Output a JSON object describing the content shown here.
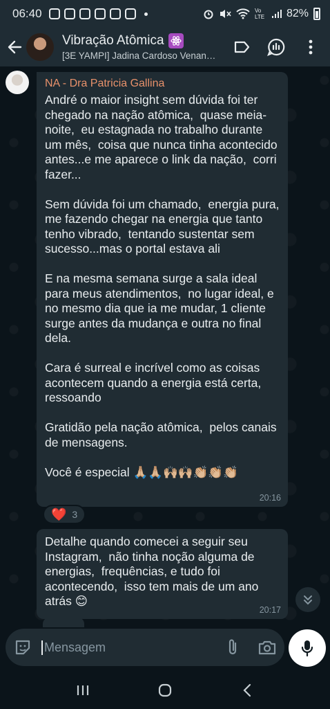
{
  "status_bar": {
    "time": "06:40",
    "battery": "82%",
    "network": "Vo LTE"
  },
  "header": {
    "title": "Vibração Atômica",
    "subtitle": "[3E YAMPI] Jadina Cardoso Venan…",
    "icons": [
      "back-arrow-icon",
      "avatar",
      "atom-badge-icon",
      "label-icon",
      "community-icon",
      "more-vert-icon"
    ]
  },
  "messages": [
    {
      "sender": "NA - Dra Patricia Gallina",
      "text": "André o maior insight sem dúvida foi ter chegado na nação atômica,  quase meia-noite,  eu estagnada no trabalho durante um mês,  coisa que nunca tinha acontecido antes...e me aparece o link da nação,  corri fazer...\n\nSem dúvida foi um chamado,  energia pura, me fazendo chegar na energia que tanto tenho vibrado,  tentando sustentar sem sucesso...mas o portal estava ali\n\nE na mesma semana surge a sala ideal para meus atendimentos,  no lugar ideal, e no mesmo dia que ia me mudar, 1 cliente surge antes da mudança e outra no final dela.\n\nCara é surreal e incrível como as coisas acontecem quando a energia está certa, ressoando\n\nGratidão pela nação atômica,  pelos canais de mensagens.\n\nVocê é especial 🙏🏼🙏🏼🙌🏼🙌🏼👏🏼👏🏼👏🏼",
      "time": "20:16",
      "reaction_emoji": "❤️",
      "reaction_count": "3"
    },
    {
      "text": "Detalhe quando comecei a seguir seu Instagram,  não tinha noção alguma de energias,  frequências, e tudo foi acontecendo,  isso tem mais de um ano atrás 😊",
      "time": "20:17"
    }
  ],
  "input": {
    "placeholder": "Mensagem"
  },
  "colors": {
    "background": "#0b141a",
    "bubble": "#202c33",
    "header": "#1f2c34",
    "sender_name": "#e8916b",
    "atom_badge": "#a64bbf"
  }
}
